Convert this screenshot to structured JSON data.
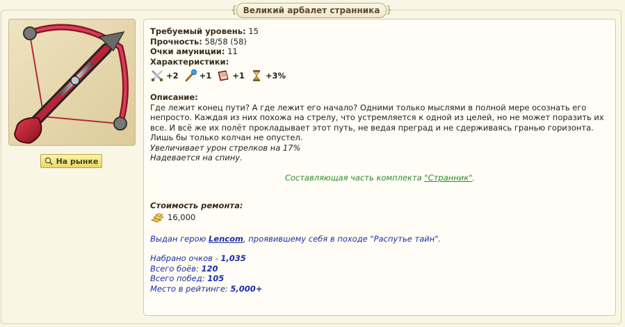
{
  "title": "Великий арбалет странника",
  "market_button": "На рынке",
  "level": {
    "label": "Требуемый уровень:",
    "value": "15"
  },
  "durability": {
    "label": "Прочность:",
    "value": "58/58  (58)"
  },
  "ammo": {
    "label": "Очки амуниции:",
    "value": "11"
  },
  "characteristics": {
    "label": "Характеристики:",
    "items": [
      {
        "icon": "attack-swords-icon",
        "value": "+2"
      },
      {
        "icon": "spell-wand-icon",
        "value": "+1"
      },
      {
        "icon": "knowledge-book-icon",
        "value": "+1"
      },
      {
        "icon": "initiative-hourglass-icon",
        "value": "+3%"
      }
    ]
  },
  "description": {
    "label": "Описание:",
    "lines": [
      "Где лежит конец пути? А где лежит его начало? Одними только мыслями в полной мере осознать его",
      "непросто. Каждая из них похожа на стрелу, что устремляется к одной из целей, но не может поразить их",
      "все. И всё же их полёт прокладывает этот путь, не ведая преград и не сдерживаясь гранью горизонта.",
      "Лишь бы только колчан не опустел."
    ],
    "effect_1": "Увеличивает урон стрелков на 17%",
    "effect_2": "Надевается на спину."
  },
  "set": {
    "prefix": "Составляющая часть комплекта ",
    "name": "\"Странник\"",
    "suffix": "."
  },
  "repair": {
    "label": "Стоимость ремонта:",
    "gold": "16,000"
  },
  "issued": {
    "prefix": "Выдан герою ",
    "hero": "Lencom",
    "suffix": ", проявившему себя в походе \"Распутье тайн\"."
  },
  "stats": [
    {
      "label": "Набрано очков - ",
      "value": "1,035"
    },
    {
      "label": "Всего боёв: ",
      "value": "120"
    },
    {
      "label": "Всего побед: ",
      "value": "105"
    },
    {
      "label": "Место в рейтинге: ",
      "value": "5,000+"
    }
  ],
  "colors": {
    "background": "#faf6e6",
    "set_green": "#2b8a2b",
    "issued_blue": "#1a2eaa"
  }
}
